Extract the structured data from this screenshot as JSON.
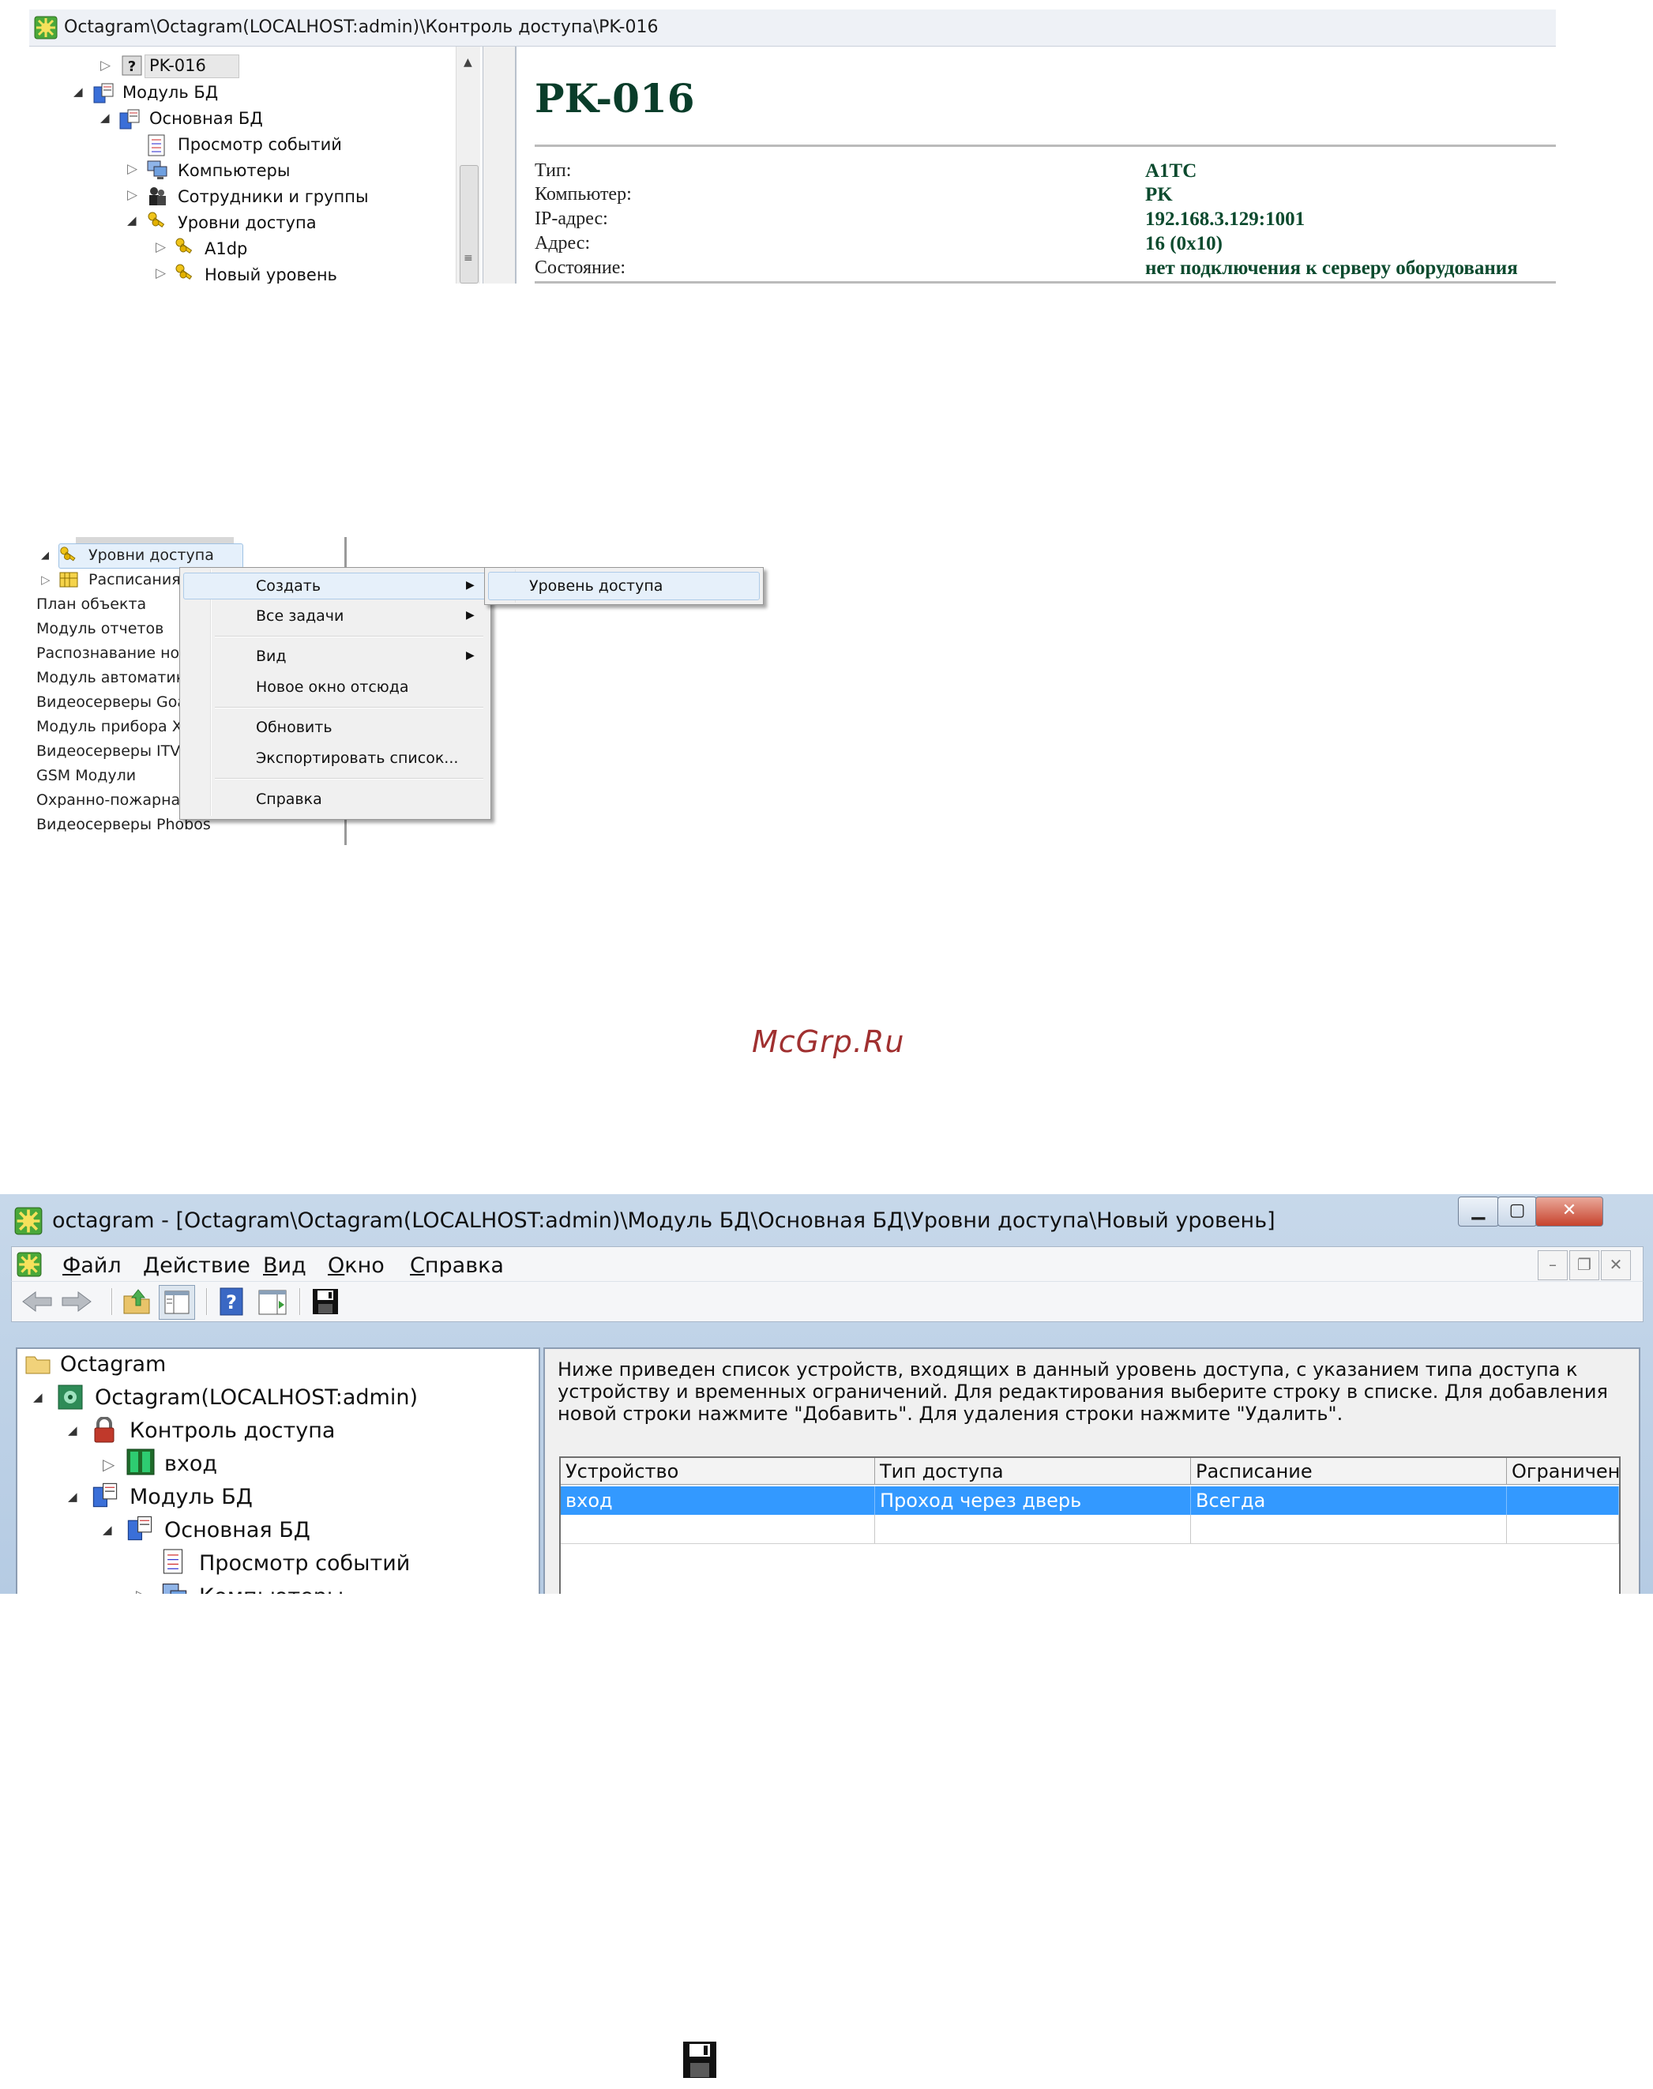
{
  "shot1": {
    "title": "Octagram\\Octagram(LOCALHOST:admin)\\Контроль доступа\\PK-016",
    "tree": [
      {
        "label": "PK-016",
        "icon": "question-icon"
      },
      {
        "label": "Модуль БД",
        "icon": "database-module-icon"
      },
      {
        "label": "Основная БД",
        "icon": "database-icon"
      },
      {
        "label": "Просмотр событий",
        "icon": "events-log-icon"
      },
      {
        "label": "Компьютеры",
        "icon": "computers-icon"
      },
      {
        "label": "Сотрудники и группы",
        "icon": "employees-icon"
      },
      {
        "label": "Уровни доступа",
        "icon": "keys-icon"
      },
      {
        "label": "A1dp",
        "icon": "keys-icon"
      },
      {
        "label": "Новый уровень",
        "icon": "keys-icon"
      }
    ],
    "heading": "PK-016",
    "props": [
      {
        "label": "Тип:",
        "value": "A1TC"
      },
      {
        "label": "Компьютер:",
        "value": "PK"
      },
      {
        "label": "IP-адрес:",
        "value": "192.168.3.129:1001"
      },
      {
        "label": "Адрес:",
        "value": "16 (0x10)"
      },
      {
        "label": "Состояние:",
        "value": "нет подключения к серверу оборудования"
      }
    ]
  },
  "shot2": {
    "tree": [
      {
        "label": "Уровни доступа"
      },
      {
        "label": "Расписания"
      },
      {
        "label": "План объекта"
      },
      {
        "label": "Модуль отчетов"
      },
      {
        "label": "Распознавание но"
      },
      {
        "label": "Модуль автоматик"
      },
      {
        "label": "Видеосерверы Goa"
      },
      {
        "label": "Модуль прибора Х"
      },
      {
        "label": "Видеосерверы ITV/"
      },
      {
        "label": "GSM Модули"
      },
      {
        "label": "Охранно-пожарна"
      },
      {
        "label": "Видеосерверы Phobos"
      }
    ],
    "menu": {
      "items": [
        {
          "label": "Создать",
          "submenu": true
        },
        {
          "label": "Все задачи",
          "submenu": true
        },
        {
          "label": "Вид",
          "submenu": true
        },
        {
          "label": "Новое окно отсюда",
          "submenu": false
        },
        {
          "label": "Обновить",
          "submenu": false
        },
        {
          "label": "Экспортировать список...",
          "submenu": false
        },
        {
          "label": "Справка",
          "submenu": false
        }
      ],
      "submenu_item": "Уровень доступа"
    }
  },
  "watermark": "McGrp.Ru",
  "shot3": {
    "title": "octagram - [Octagram\\Octagram(LOCALHOST:admin)\\Модуль БД\\Основная БД\\Уровни доступа\\Новый уровень]",
    "menubar": [
      {
        "label": "Файл",
        "accel": "Ф",
        "rest": "айл"
      },
      {
        "label": "Действие",
        "accel": "Д",
        "rest": "ействие"
      },
      {
        "label": "Вид",
        "accel": "В",
        "rest": "ид"
      },
      {
        "label": "Окно",
        "accel": "О",
        "rest": "кно"
      },
      {
        "label": "Справка",
        "accel": "С",
        "rest": "правка"
      }
    ],
    "caption_buttons": {
      "minimize": "▁",
      "maximize": "▢",
      "close": "✕"
    },
    "mdi_buttons": {
      "minimize": "–",
      "restore": "❐",
      "close": "✕"
    },
    "toolbar_icons": [
      "back-icon",
      "forward-icon",
      "up-folder-icon",
      "show-hide-tree-icon",
      "help-icon",
      "action-pane-icon",
      "save-icon"
    ],
    "tree": [
      {
        "label": "Octagram",
        "icon": "folder-icon"
      },
      {
        "label": "Octagram(LOCALHOST:admin)",
        "icon": "server-icon"
      },
      {
        "label": "Контроль доступа",
        "icon": "lock-icon"
      },
      {
        "label": "вход",
        "icon": "door-icon"
      },
      {
        "label": "Модуль БД",
        "icon": "database-module-icon"
      },
      {
        "label": "Основная БД",
        "icon": "database-icon"
      },
      {
        "label": "Просмотр событий",
        "icon": "events-log-icon"
      },
      {
        "label": "Компьютеры",
        "icon": "computers-icon"
      }
    ],
    "description": "Ниже приведен список устройств, входящих в данный уровень доступа, с указанием типа доступа к устройству и временных ограничений. Для редактирования выберите строку в списке. Для добавления новой строки нажмите \"Добавить\". Для удаления строки нажмите \"Удалить\".",
    "table": {
      "columns": [
        "Устройство",
        "Тип доступа",
        "Расписание",
        "Ограничени"
      ],
      "rows": [
        {
          "cells": [
            "вход",
            "Проход через дверь",
            "Всегда",
            ""
          ],
          "selected": true
        }
      ]
    }
  },
  "colors": {
    "heading": "#0a3d2a",
    "value": "#0c4a2e",
    "watermark": "#a03030",
    "selection": "#3399ff"
  }
}
